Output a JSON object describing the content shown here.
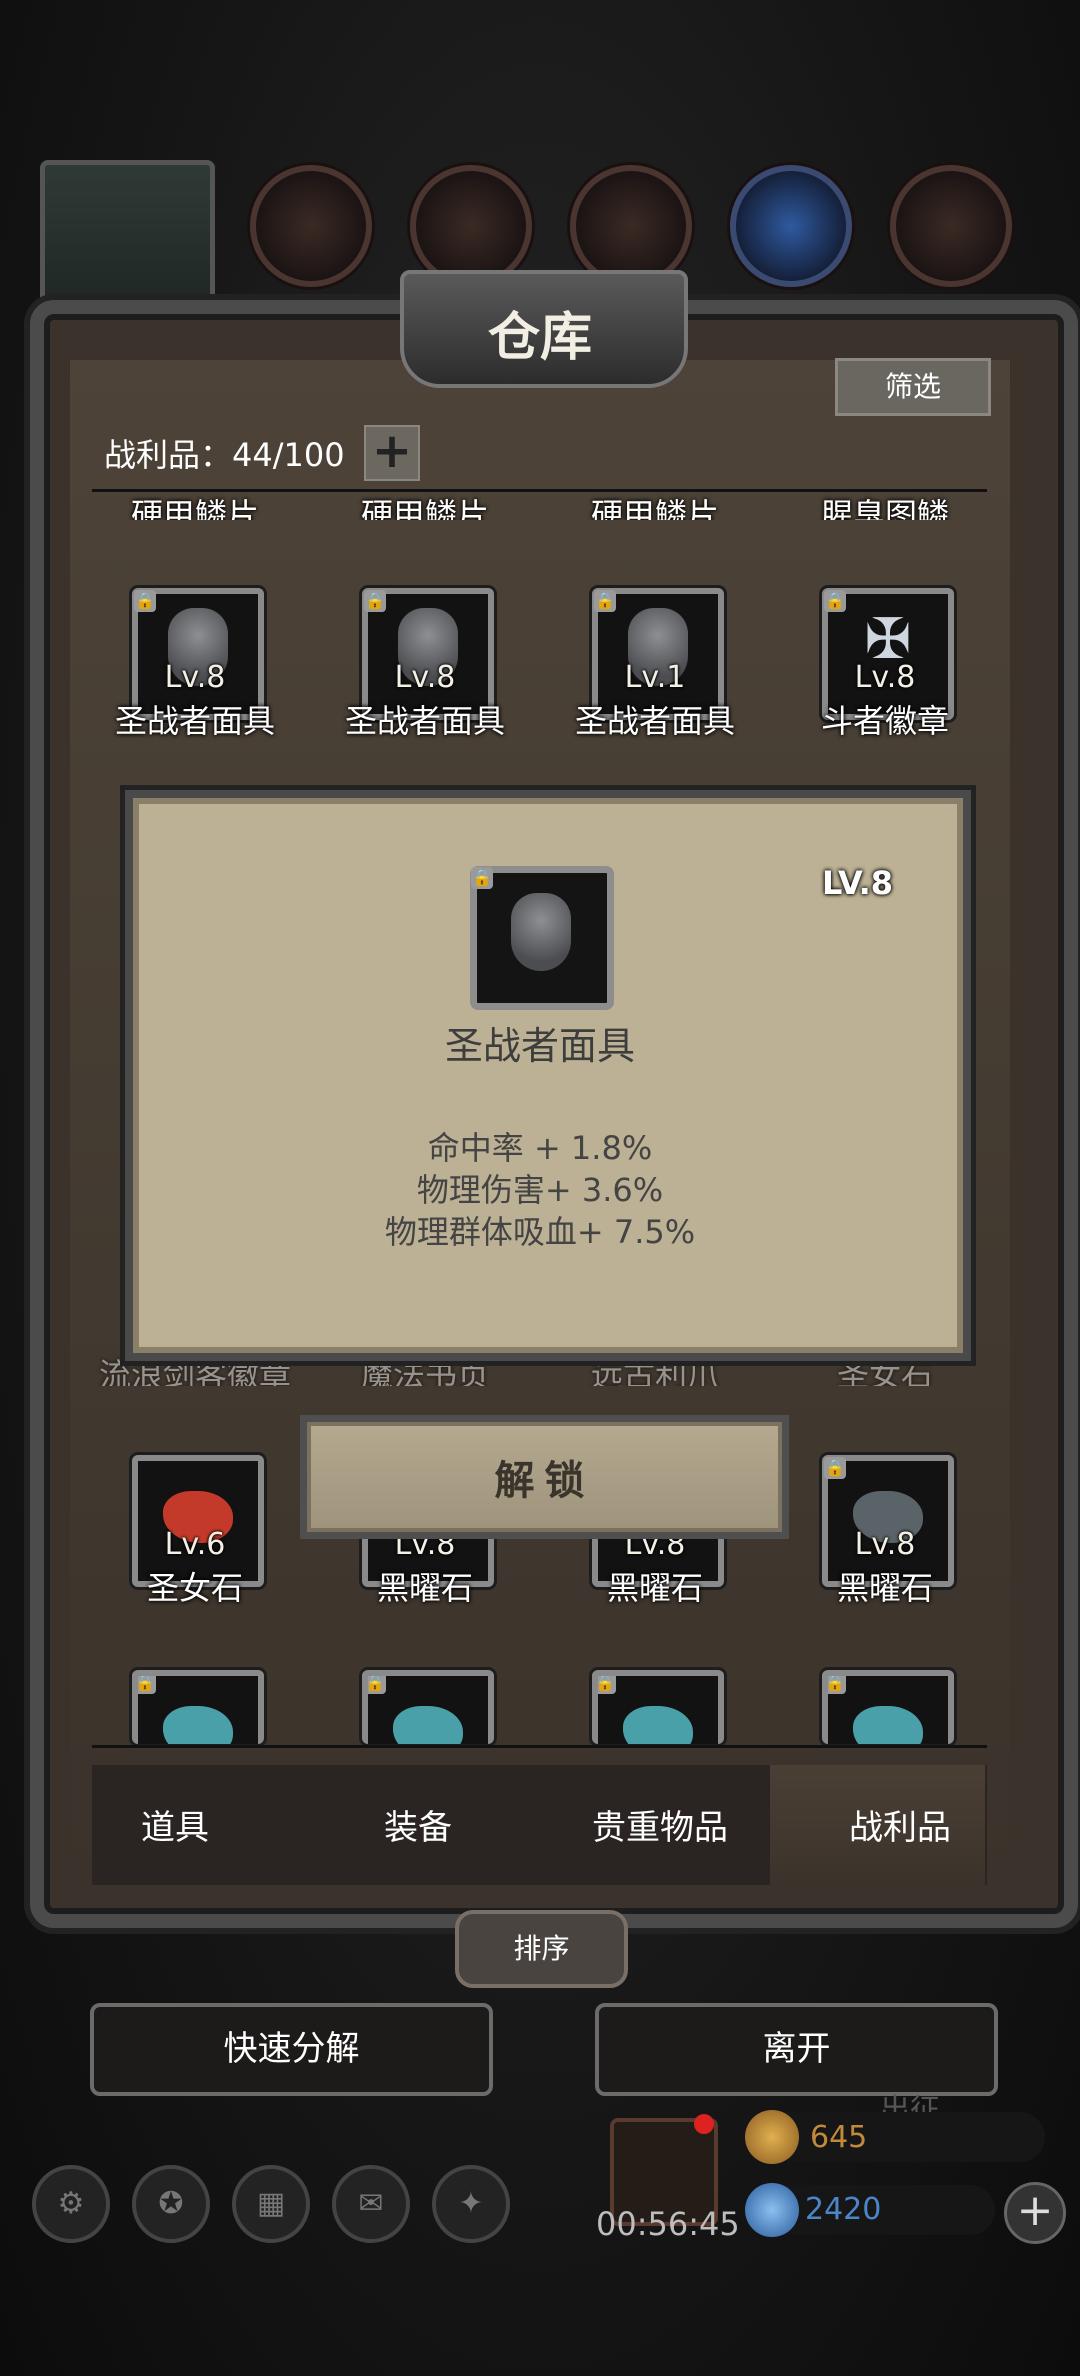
{
  "window": {
    "title": "仓库"
  },
  "header": {
    "filter_label": "筛选",
    "loot_count": "战利品：44/100",
    "add_symbol": "+"
  },
  "rows": {
    "partial_top": [
      "硬甲鳞片",
      "硬甲鳞片",
      "硬甲鳞片",
      "腥臭图鳞"
    ],
    "row1": [
      {
        "level": "Lv.8",
        "name": "圣战者面具",
        "locked": true
      },
      {
        "level": "Lv.8",
        "name": "圣战者面具",
        "locked": true
      },
      {
        "level": "Lv.1",
        "name": "圣战者面具",
        "locked": true
      },
      {
        "level": "Lv.8",
        "name": "斗者徽章",
        "locked": true
      }
    ],
    "row3_names": [
      "流浪剑客徽章",
      "魔法书页",
      "远古利爪",
      "圣女石"
    ],
    "row4": [
      {
        "level": "Lv.6",
        "name": "圣女石",
        "locked": false
      },
      {
        "level": "Lv.8",
        "name": "黑曜石",
        "locked": true
      },
      {
        "level": "Lv.8",
        "name": "黑曜石",
        "locked": true
      },
      {
        "level": "Lv.8",
        "name": "黑曜石",
        "locked": true
      }
    ]
  },
  "popup": {
    "level": "LV.8",
    "name": "圣战者面具",
    "stats": [
      "命中率 + 1.8%",
      "物理伤害+ 3.6%",
      "物理群体吸血+ 7.5%"
    ],
    "unlock_label": "解锁"
  },
  "tabs": {
    "items": [
      "道具",
      "装备",
      "贵重物品",
      "战利品"
    ],
    "active": "战利品"
  },
  "actions": {
    "sort_label": "排序",
    "quick_decompose_label": "快速分解",
    "leave_label": "离开"
  },
  "bottom": {
    "timer": "00:56:45",
    "gold": "645",
    "gems": "2420",
    "partial_text": "出征"
  },
  "colors": {
    "gold": "#c08a3a",
    "gem": "#4a86c8",
    "stone_red": "#c43a2a",
    "stone_teal": "#4aa0a8",
    "stone_gray": "#5a6468"
  }
}
